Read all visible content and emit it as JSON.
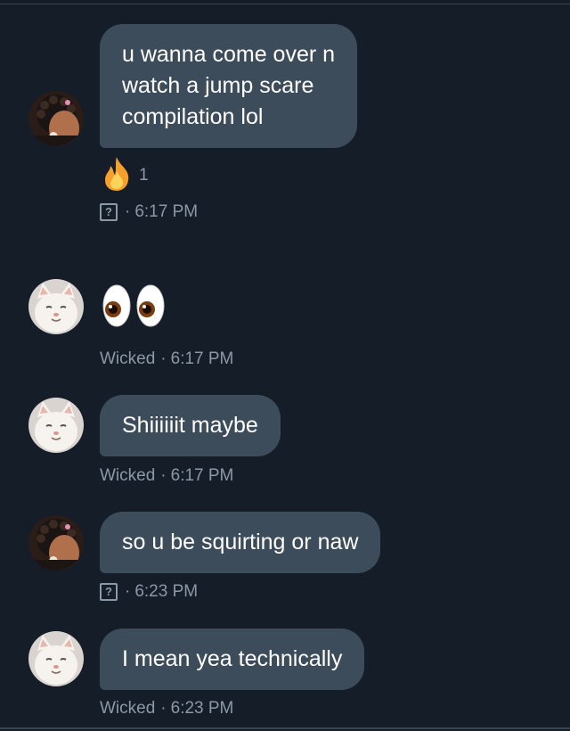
{
  "conversation": {
    "messages": [
      {
        "sender": "other",
        "avatar": "curly-hair-avatar",
        "lines": [
          "u wanna come over n",
          "watch a jump scare",
          "compilation lol"
        ],
        "reaction": {
          "icon": "fire-emoji",
          "count": "1"
        },
        "status_icon": "unknown-glyph-icon",
        "separator": "·",
        "time": "6:17 PM"
      },
      {
        "sender": "self",
        "avatar": "white-cat-avatar",
        "emoji": "eyes-emoji",
        "name": "Wicked",
        "separator": "·",
        "time": "6:17 PM"
      },
      {
        "sender": "self",
        "avatar": "white-cat-avatar",
        "text": "Shiiiiiit maybe",
        "name": "Wicked",
        "separator": "·",
        "time": "6:17 PM"
      },
      {
        "sender": "other",
        "avatar": "curly-hair-avatar",
        "text": "so u be squirting or naw",
        "status_icon": "unknown-glyph-icon",
        "separator": "·",
        "time": "6:23 PM"
      },
      {
        "sender": "self",
        "avatar": "white-cat-avatar",
        "text": "I mean yea technically",
        "name": "Wicked",
        "separator": "·",
        "time": "6:23 PM"
      }
    ]
  },
  "glyphs": {
    "unknown": "?"
  },
  "colors": {
    "background": "#151d28",
    "bubble": "#3d4c5a",
    "meta_text": "#8b98a5",
    "divider": "#38444d"
  }
}
